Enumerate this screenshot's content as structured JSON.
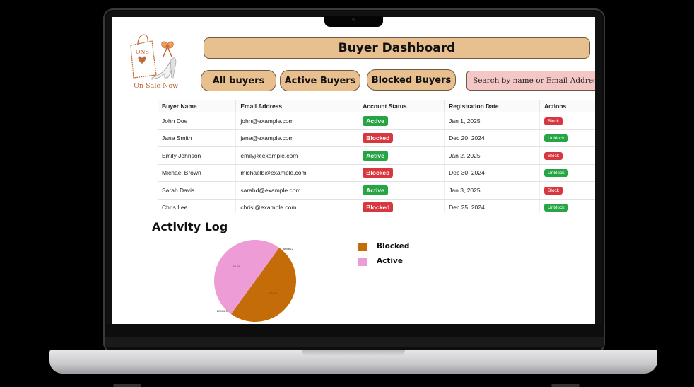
{
  "logo": {
    "brand_initials": "ONS",
    "caption": "- On Sale Now -"
  },
  "header": {
    "title": "Buyer Dashboard"
  },
  "filters": {
    "all": "All buyers",
    "active": "Active Buyers",
    "blocked": "Blocked Buyers"
  },
  "search": {
    "placeholder": "Search by name or Email Address"
  },
  "table": {
    "columns": [
      "Buyer Name",
      "Email Address",
      "Account Status",
      "Registration Date",
      "Actions"
    ],
    "rows": [
      {
        "name": "John Doe",
        "email": "john@example.com",
        "status": "Active",
        "date": "Jan 1, 2025",
        "action": "Block"
      },
      {
        "name": "Jane Smith",
        "email": "jane@example.com",
        "status": "Blocked",
        "date": "Dec 20, 2024",
        "action": "Unblock"
      },
      {
        "name": "Emily Johnson",
        "email": "emilyj@example.com",
        "status": "Active",
        "date": "Jan 2, 2025",
        "action": "Block"
      },
      {
        "name": "Michael Brown",
        "email": "michaelb@example.com",
        "status": "Blocked",
        "date": "Dec 30, 2024",
        "action": "Unblock"
      },
      {
        "name": "Sarah Davis",
        "email": "sarahd@example.com",
        "status": "Active",
        "date": "Jan 3, 2025",
        "action": "Block"
      },
      {
        "name": "Chris Lee",
        "email": "chrisl@example.com",
        "status": "Blocked",
        "date": "Dec 25, 2024",
        "action": "Unblock"
      }
    ]
  },
  "activity": {
    "title": "Activity Log",
    "legend": [
      {
        "label": "Blocked",
        "color": "#c46c07"
      },
      {
        "label": "Active",
        "color": "#ee9cd6"
      }
    ]
  },
  "chart_data": {
    "type": "pie",
    "slices": [
      {
        "label": "Blocked",
        "value": 50,
        "color": "#c46c07",
        "pct_label": "50.0%",
        "outer_label": "BF8602"
      },
      {
        "label": "Active",
        "value": 50,
        "color": "#ee9cd6",
        "pct_label": "50.0%",
        "outer_label": "EE9BD6"
      }
    ],
    "legend_position": "right"
  }
}
